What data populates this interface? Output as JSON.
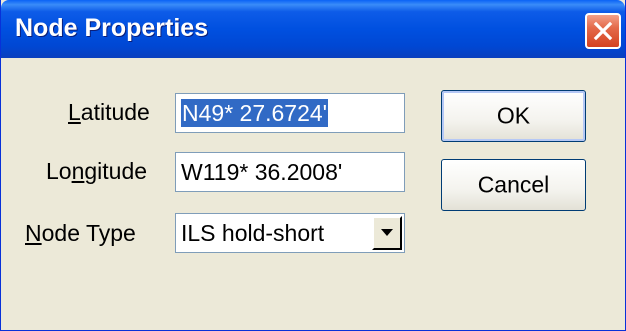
{
  "window": {
    "title": "Node Properties",
    "close_icon": "close-icon"
  },
  "form": {
    "latitude": {
      "label_access_key": "L",
      "label_rest": "atitude",
      "value": "N49* 27.6724'",
      "selected": true
    },
    "longitude": {
      "label_before": "Lo",
      "label_access_key": "n",
      "label_rest": "gitude",
      "value": "W119* 36.2008'"
    },
    "node_type": {
      "label_access_key": "N",
      "label_rest": "ode Type",
      "selected_option": "ILS hold-short",
      "dropdown_icon": "chevron-down-icon"
    }
  },
  "buttons": {
    "ok_label": "OK",
    "cancel_label": "Cancel"
  },
  "colors": {
    "title_bar": "#0050e0",
    "selection": "#316ac5",
    "dialog_bg": "#ece9d8",
    "close_button": "#d4411f"
  }
}
